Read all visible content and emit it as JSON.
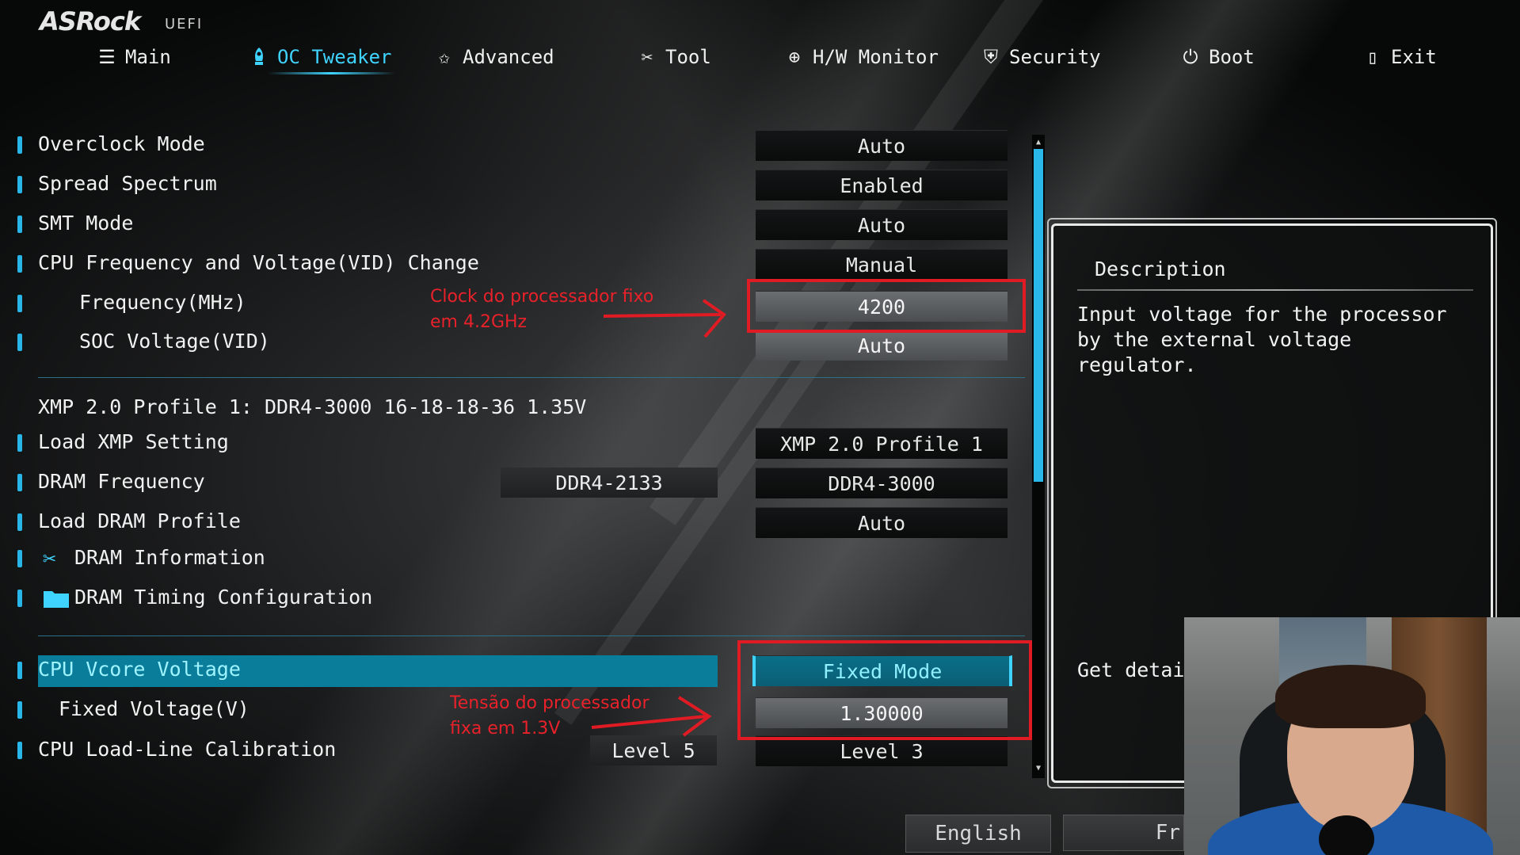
{
  "header": {
    "brand": "ASRock",
    "brand_sub": "UEFI"
  },
  "nav": {
    "active": "OC Tweaker",
    "items": [
      {
        "label": "Main",
        "icon": "list-icon"
      },
      {
        "label": "OC Tweaker",
        "icon": "rocket-icon"
      },
      {
        "label": "Advanced",
        "icon": "star-icon"
      },
      {
        "label": "Tool",
        "icon": "tools-icon"
      },
      {
        "label": "H/W Monitor",
        "icon": "gauge-icon"
      },
      {
        "label": "Security",
        "icon": "shield-icon"
      },
      {
        "label": "Boot",
        "icon": "power-icon"
      },
      {
        "label": "Exit",
        "icon": "exit-door-icon"
      }
    ]
  },
  "settings": {
    "overclock_mode": {
      "label": "Overclock Mode",
      "value": "Auto"
    },
    "spread_spectrum": {
      "label": "Spread Spectrum",
      "value": "Enabled"
    },
    "smt_mode": {
      "label": "SMT Mode",
      "value": "Auto"
    },
    "cpu_freq_vid": {
      "label": "CPU Frequency and Voltage(VID) Change",
      "value": "Manual"
    },
    "frequency": {
      "label": "Frequency(MHz)",
      "value": "4200"
    },
    "soc_voltage": {
      "label": "SOC Voltage(VID)",
      "value": "Auto"
    },
    "xmp_profile_info": "XMP 2.0 Profile 1: DDR4-3000 16-18-18-36 1.35V",
    "load_xmp": {
      "label": "Load XMP Setting",
      "value": "XMP 2.0 Profile 1"
    },
    "dram_frequency": {
      "label": "DRAM Frequency",
      "current": "DDR4-2133",
      "value": "DDR4-3000"
    },
    "load_dram_profile": {
      "label": "Load DRAM Profile",
      "value": "Auto"
    },
    "dram_information": {
      "label": "DRAM Information",
      "icon": "tools-icon"
    },
    "dram_timing": {
      "label": "DRAM Timing Configuration",
      "icon": "folder-icon"
    },
    "cpu_vcore": {
      "label": "CPU Vcore Voltage",
      "value": "Fixed Mode"
    },
    "fixed_voltage": {
      "label": "Fixed Voltage(V)",
      "value": "1.30000"
    },
    "cpu_llc": {
      "label": "CPU Load-Line Calibration",
      "current": "Level 5",
      "value": "Level 3"
    }
  },
  "description": {
    "title": "Description",
    "text": "Input voltage for the processor by the external voltage regulator.",
    "more": "Get details"
  },
  "annotations": {
    "clock": {
      "line1": "Clock do processador fixo",
      "line2": "em 4.2GHz"
    },
    "voltage": {
      "line1": "Tensão do processador",
      "line2": "fixa em 1.3V"
    }
  },
  "language": {
    "current": "English",
    "next": "Fr"
  },
  "colors": {
    "accent": "#3fd4ff",
    "highlight_row": "#0a7d9a",
    "annotation_red": "#e01b24"
  }
}
